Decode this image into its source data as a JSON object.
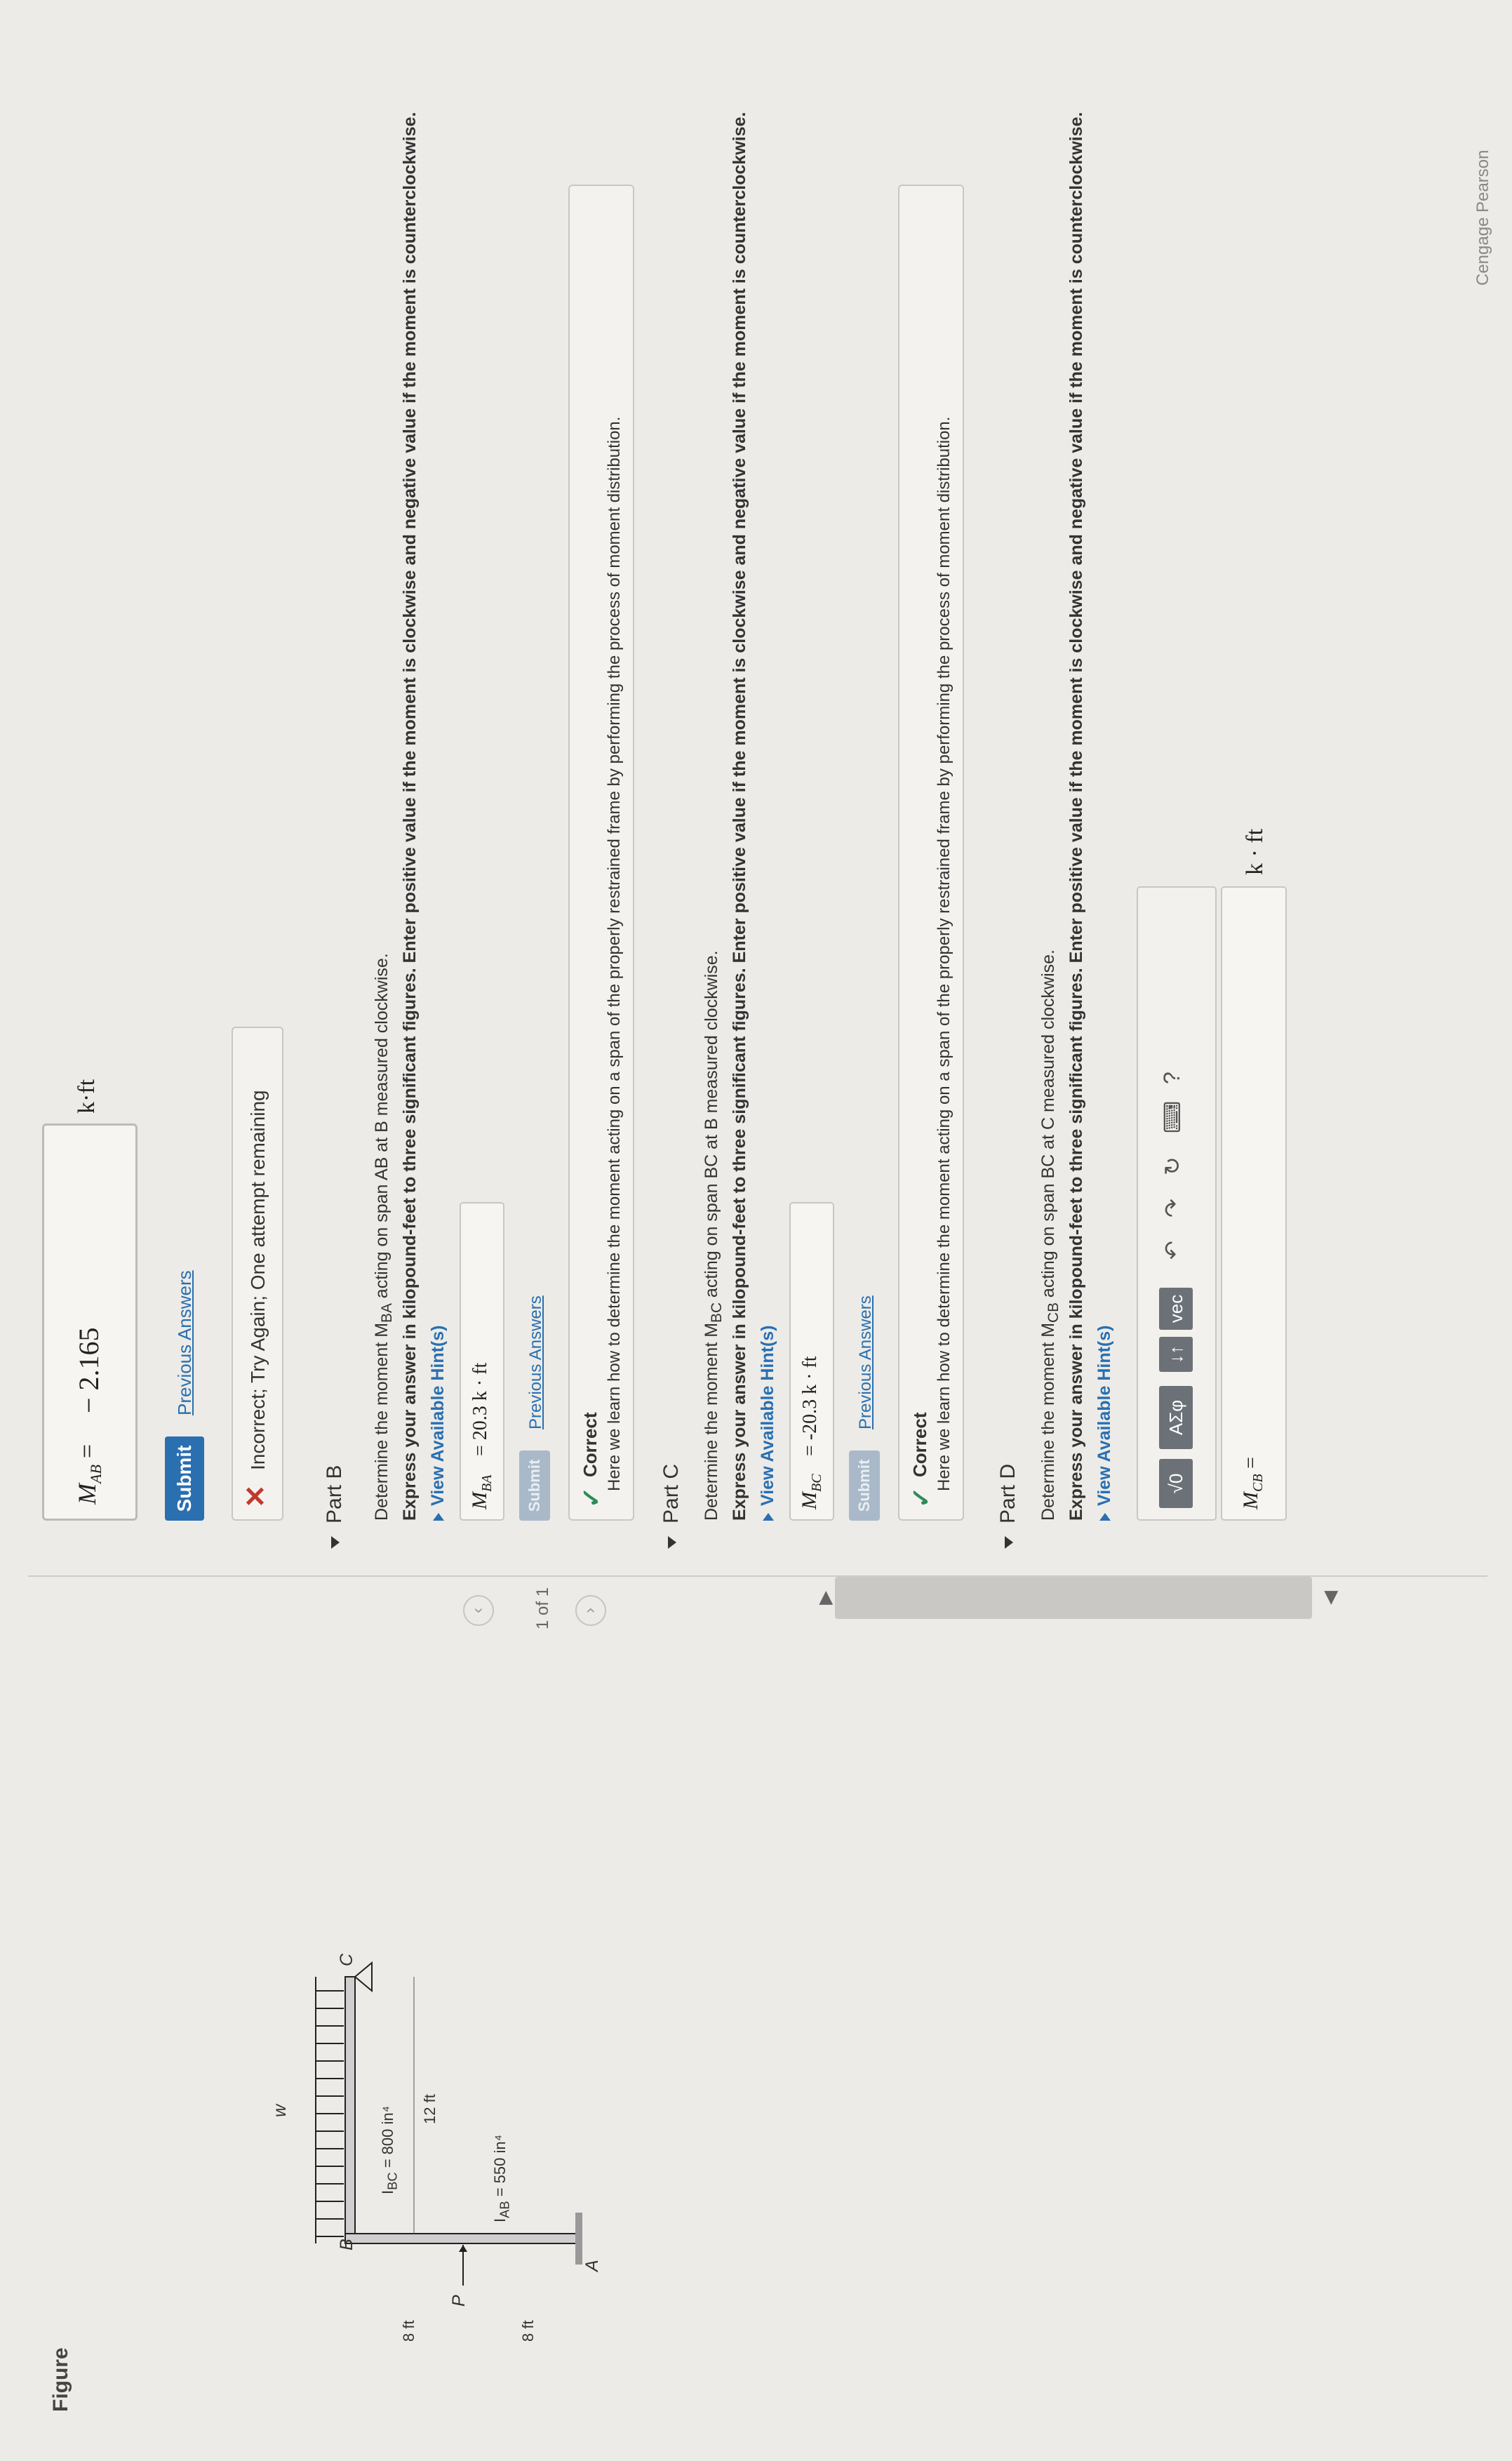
{
  "partA": {
    "label": "M",
    "label_sub": "AB",
    "equals": "=",
    "value": "− 2.165",
    "unit": "k·ft",
    "submit": "Submit",
    "previous_answers": "Previous Answers",
    "feedback": "Incorrect; Try Again; One attempt remaining"
  },
  "partB": {
    "title": "Part B",
    "prompt": "Determine the moment M",
    "prompt_sub": "BA",
    "prompt_rest": " acting on span AB at B measured clockwise.",
    "instructions": "Express your answer in kilopound-feet to three significant figures. Enter positive value if the moment is clockwise and negative value if the moment is counterclockwise.",
    "hints": "View Available Hint(s)",
    "answer_label": "M",
    "answer_sub": "BA",
    "answer_value": "= 20.3  k · ft",
    "submit": "Submit",
    "previous_answers": "Previous Answers",
    "feedback_title": "Correct",
    "feedback_text": "Here we learn how to determine the moment acting on a span of the properly restrained frame by performing the process of moment distribution."
  },
  "partC": {
    "title": "Part C",
    "prompt": "Determine the moment M",
    "prompt_sub": "BC",
    "prompt_rest": " acting on span BC at B measured clockwise.",
    "instructions": "Express your answer in kilopound-feet to three significant figures. Enter positive value if the moment is clockwise and negative value if the moment is counterclockwise.",
    "hints": "View Available Hint(s)",
    "answer_label": "M",
    "answer_sub": "BC",
    "answer_value": "= -20.3  k · ft",
    "submit": "Submit",
    "previous_answers": "Previous Answers",
    "feedback_title": "Correct",
    "feedback_text": "Here we learn how to determine the moment acting on a span of the properly restrained frame by performing the process of moment distribution."
  },
  "partD": {
    "title": "Part D",
    "prompt": "Determine the moment M",
    "prompt_sub": "CB",
    "prompt_rest": " acting on span BC at C measured clockwise.",
    "instructions": "Express your answer in kilopound-feet to three significant figures. Enter positive value if the moment is clockwise and negative value if the moment is counterclockwise.",
    "hints": "View Available Hint(s)",
    "toolbar": {
      "templates": "√0",
      "greek": "ΑΣφ",
      "sub": "↓↑",
      "vec": "vec",
      "undo": "↶",
      "redo": "↷",
      "reset": "↻",
      "keyboard": "⌨",
      "help": "?"
    },
    "answer_label": "M",
    "answer_sub": "CB",
    "answer_equals": "=",
    "unit": "k · ft"
  },
  "figure": {
    "title": "Figure",
    "pager": "1 of 1",
    "labels": {
      "w": "w",
      "B": "B",
      "C": "C",
      "A": "A",
      "P": "P",
      "ibc": "I",
      "ibc_sub": "BC",
      "ibc_val": " = 800 in⁴",
      "iab": "I",
      "iab_sub": "AB",
      "iab_val": " = 550 in⁴",
      "span": "12 ft",
      "h1": "8 ft",
      "h2": "8 ft"
    }
  },
  "footer": {
    "brand": "Cengage Pearson"
  }
}
